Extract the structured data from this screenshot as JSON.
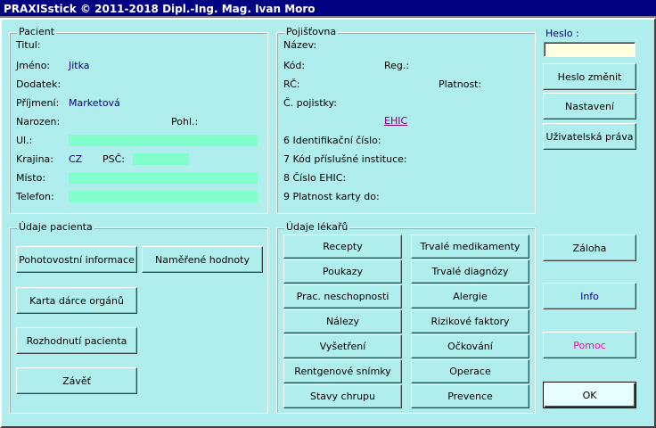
{
  "window": {
    "title": "PRAXISstick © 2011-2018 Dipl.-Ing. Mag. Ivan Moro"
  },
  "pacient": {
    "legend": "Pacient",
    "titul_label": "Titul:",
    "jmeno_label": "Jméno:",
    "jmeno_value": "Jitka",
    "dodatek_label": "Dodatek:",
    "prijmeni_label": "Příjmení:",
    "prijmeni_value": "Marketová",
    "narozen_label": "Narozen:",
    "pohl_label": "Pohl.:",
    "ul_label": "Ul.:",
    "krajina_label": "Krajina:",
    "krajina_value": "CZ",
    "psc_label": "PSČ:",
    "misto_label": "Místo:",
    "telefon_label": "Telefon:"
  },
  "pojistovna": {
    "legend": "Pojišťovna",
    "nazev_label": "Název:",
    "kod_label": "Kód:",
    "reg_label": "Reg.:",
    "rc_label": "RČ:",
    "platnost_label": "Platnost:",
    "cislo_pojistky_label": "Č. pojistky:",
    "ehic_link": "EHIC",
    "identifikacni_cislo_label": "6 Identifikační číslo:",
    "kod_instituce_label": "7 Kód příslušné instituce:",
    "cislo_ehic_label": "8 Číslo EHIC:",
    "platnost_karty_label": "9 Platnost karty do:"
  },
  "udaje_pacienta": {
    "legend": "Údaje pacienta",
    "buttons": {
      "pohotovostni": "Pohotovostní informace",
      "namerene": "Naměřené hodnoty",
      "karta_darce": "Karta dárce orgánů",
      "rozhodnuti": "Rozhodnutí pacienta",
      "zaver": "Závěť"
    }
  },
  "udaje_lekaru": {
    "legend": "Údaje lékařů",
    "left_buttons": [
      "Recepty",
      "Poukazy",
      "Prac. neschopnosti",
      "Nálezy",
      "Vyšetření",
      "Rentgenové snímky",
      "Stavy chrupu"
    ],
    "right_buttons": [
      "Trvalé medikamenty",
      "Trvalé diagnózy",
      "Alergie",
      "Rizikové faktory",
      "Očkování",
      "Operace",
      "Prevence"
    ]
  },
  "right_panel": {
    "heslo_label": "Heslo :",
    "heslo_value": "",
    "heslo_zmenit": "Heslo změnit",
    "nastaveni": "Nastavení",
    "uzivatelska_prava": "Uživatelská práva",
    "zaloha": "Záloha",
    "info": "Info",
    "pomoc": "Pomoc",
    "ok": "OK"
  },
  "colors": {
    "background": "#b0eeee",
    "title_bar": "#000080",
    "field": "#80ffcc",
    "value_text": "#000080",
    "info_text": "#000080",
    "pomoc_text": "#ff00aa",
    "link": "#800080"
  }
}
